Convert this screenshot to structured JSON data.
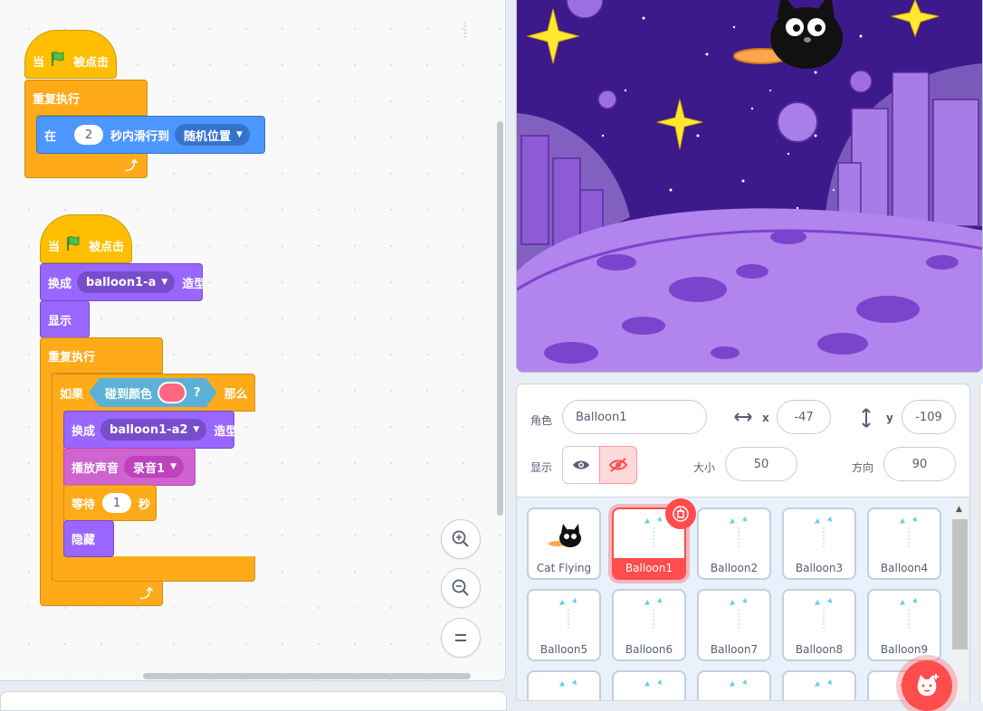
{
  "scripts": {
    "script1": {
      "hat": {
        "prefix": "当",
        "suffix": "被点击"
      },
      "forever": "重复执行",
      "glide": {
        "prefix": "在",
        "secs": "2",
        "mid": "秒内滑行到",
        "target": "随机位置"
      }
    },
    "script2": {
      "hat": {
        "prefix": "当",
        "suffix": "被点击"
      },
      "switch_costume": {
        "prefix": "换成",
        "costume": "balloon1-a",
        "suffix": "造型"
      },
      "show": "显示",
      "forever": "重复执行",
      "if": {
        "prefix": "如果",
        "sensing_label": "碰到颜色",
        "question": "?",
        "then": "那么",
        "color": "#ff6680"
      },
      "switch_costume2": {
        "prefix": "换成",
        "costume": "balloon1-a2",
        "suffix": "造型"
      },
      "play_sound": {
        "prefix": "播放声音",
        "sound": "录音1"
      },
      "wait": {
        "prefix": "等待",
        "secs": "1",
        "suffix": "秒"
      },
      "hide": "隐藏"
    }
  },
  "sprite_info": {
    "sprite_label": "角色",
    "sprite_name": "Balloon1",
    "x_label": "x",
    "x_value": "-47",
    "y_label": "y",
    "y_value": "-109",
    "show_label": "显示",
    "size_label": "大小",
    "size_value": "50",
    "direction_label": "方向",
    "direction_value": "90"
  },
  "sprites": [
    {
      "name": "Cat Flying",
      "selected": false
    },
    {
      "name": "Balloon1",
      "selected": true
    },
    {
      "name": "Balloon2",
      "selected": false
    },
    {
      "name": "Balloon3",
      "selected": false
    },
    {
      "name": "Balloon4",
      "selected": false
    },
    {
      "name": "Balloon5",
      "selected": false
    },
    {
      "name": "Balloon6",
      "selected": false
    },
    {
      "name": "Balloon7",
      "selected": false
    },
    {
      "name": "Balloon8",
      "selected": false
    },
    {
      "name": "Balloon9",
      "selected": false
    }
  ],
  "colors": {
    "events": "#ffbf00",
    "control": "#ffab19",
    "motion": "#4c97ff",
    "looks": "#9966ff",
    "sound": "#cf63cf",
    "sensing": "#5cb1d6",
    "selected": "#ff4c4c",
    "stage_sky": "#3d1a8c"
  },
  "icons": [
    "green-flag-icon",
    "zoom-in-icon",
    "zoom-out-icon",
    "zoom-reset-icon",
    "loop-arrow-icon",
    "dropdown-caret-icon",
    "eye-icon",
    "eye-slash-icon",
    "horizontal-arrows-icon",
    "vertical-arrows-icon",
    "trash-icon",
    "add-sprite-icon"
  ]
}
